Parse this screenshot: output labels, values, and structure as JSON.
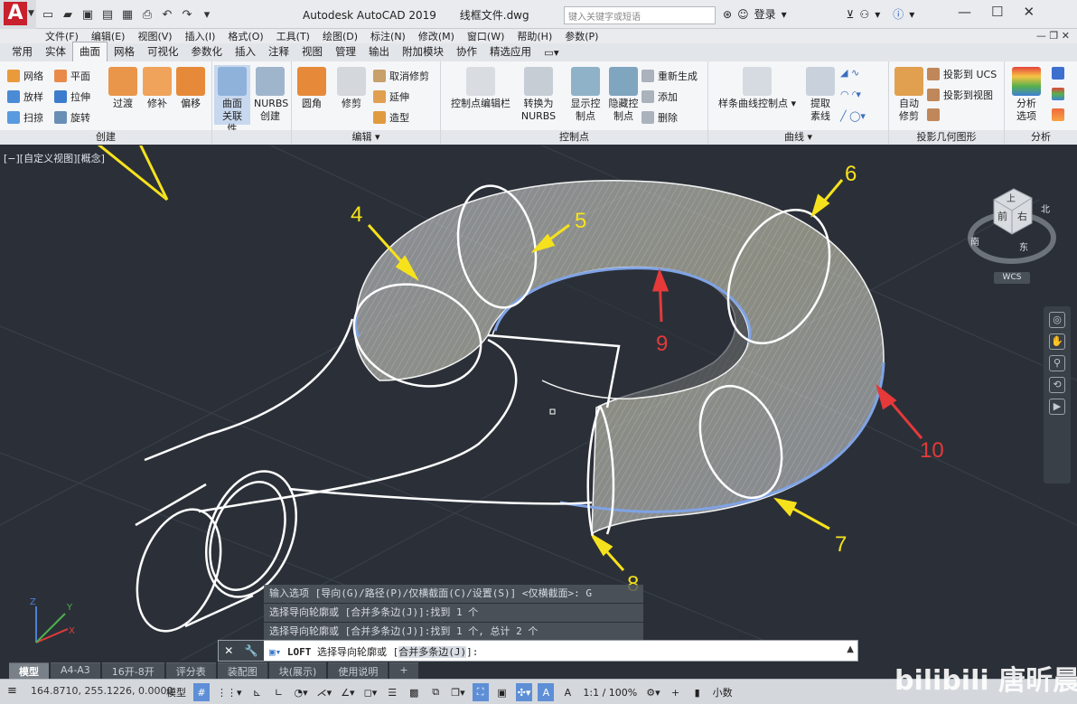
{
  "titlebar": {
    "app_name": "Autodesk AutoCAD 2019",
    "file_name": "线框文件.dwg",
    "search_placeholder": "键入关键字或短语",
    "login_label": "登录"
  },
  "menu": [
    "文件(F)",
    "编辑(E)",
    "视图(V)",
    "插入(I)",
    "格式(O)",
    "工具(T)",
    "绘图(D)",
    "标注(N)",
    "修改(M)",
    "窗口(W)",
    "帮助(H)",
    "参数(P)"
  ],
  "ribbon_tabs": [
    "常用",
    "实体",
    "曲面",
    "网格",
    "可视化",
    "参数化",
    "插入",
    "注释",
    "视图",
    "管理",
    "输出",
    "附加模块",
    "协作",
    "精选应用"
  ],
  "active_tab": "曲面",
  "ribbon": {
    "create": {
      "small": [
        "网络",
        "平面",
        "放样",
        "拉伸",
        "扫掠",
        "旋转"
      ],
      "big": [
        "过渡",
        "修补",
        "偏移",
        "曲面关联性",
        "NURBS 创建"
      ],
      "footer": "创建"
    },
    "edit": {
      "big": [
        "圆角",
        "修剪"
      ],
      "small": [
        "取消修剪",
        "延伸",
        "造型"
      ],
      "footer": "编辑"
    },
    "cv": {
      "big": [
        "控制点编辑栏",
        "转换为 NURBS",
        "显示控制点",
        "隐藏控制点"
      ],
      "small": [
        "重新生成",
        "添加",
        "删除"
      ],
      "footer": "控制点"
    },
    "curves": {
      "big": [
        "样条曲线控制点",
        "提取素线"
      ],
      "footer": "曲线"
    },
    "project": {
      "big": [
        "自动修剪"
      ],
      "small": [
        "投影到 UCS",
        "投影到视图"
      ],
      "footer": "投影几何图形"
    },
    "analysis": {
      "big": [
        "分析选项"
      ],
      "footer": "分析"
    }
  },
  "viewport": {
    "label": "[−][自定义视图][概念]",
    "callouts": [
      "4",
      "5",
      "6",
      "7",
      "8",
      "9",
      "10"
    ],
    "navcube": {
      "top": "上",
      "front": "前",
      "right": "右",
      "north": "北",
      "south": "南",
      "east": "东"
    },
    "wcs": "WCS"
  },
  "command_history": [
    "输入选项 [导向(G)/路径(P)/仅横截面(C)/设置(S)] <仅横截面>: G",
    "选择导向轮廓或 [合并多条边(J)]:找到 1 个",
    "选择导向轮廓或 [合并多条边(J)]:找到 1 个, 总计 2 个"
  ],
  "command_line": {
    "cmd": "LOFT",
    "prompt": "选择导向轮廓或 [",
    "option": "合并多条边(J)",
    "end": "]:"
  },
  "layout_tabs": [
    "模型",
    "A4-A3",
    "16开-8开",
    "评分表",
    "装配图",
    "块(展示)",
    "使用说明"
  ],
  "status": {
    "coords": "164.8710, 255.1226, 0.0000",
    "model": "模型",
    "scale": "1:1 / 100%",
    "units": "小数"
  },
  "watermark": "bilibili 唐昕晨",
  "colors": {
    "accent": "#5e8fd6",
    "callout_yellow": "#f6e21c",
    "callout_red": "#e5393a",
    "viewport_bg": "#2b3038"
  }
}
